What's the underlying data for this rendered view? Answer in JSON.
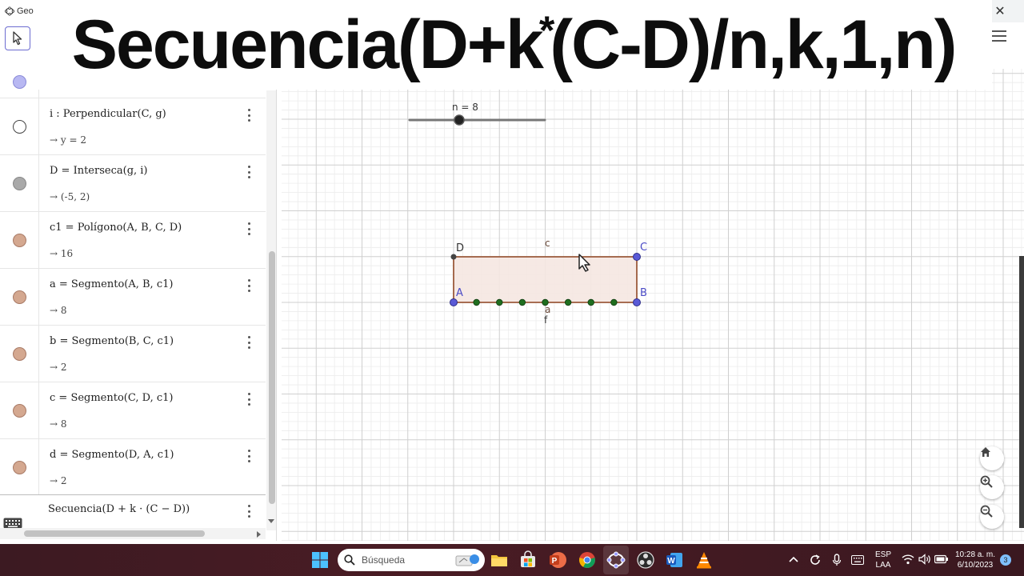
{
  "browser": {
    "tab_title": "Geo",
    "close_glyph": "✕"
  },
  "overlay": {
    "title_part1": "Secuencia(D+k",
    "title_sup": "*",
    "title_part2": "(C-D)/n,k,1,n)"
  },
  "algebra": {
    "rows": [
      {
        "definition": "i : Perpendicular(C, g)",
        "value": "→ y = 2",
        "marker": "hollow"
      },
      {
        "definition": "D = Interseca(g, i)",
        "value": "→ (-5, 2)",
        "marker": "#a9a9a9"
      },
      {
        "definition": "c1 = Polígono(A, B, C, D)",
        "value": "→ 16",
        "marker": "#d4a890"
      },
      {
        "definition": "a = Segmento(A, B, c1)",
        "value": "→ 8",
        "marker": "#d4a890"
      },
      {
        "definition": "b = Segmento(B, C, c1)",
        "value": "→ 2",
        "marker": "#d4a890"
      },
      {
        "definition": "c = Segmento(C, D, c1)",
        "value": "→ 8",
        "marker": "#d4a890"
      },
      {
        "definition": "d = Segmento(D, A, c1)",
        "value": "→ 2",
        "marker": "#d4a890"
      }
    ],
    "input_row": "Secuencia(D + k · (C − D))"
  },
  "graphics": {
    "slider_label": "n = 8",
    "slider_value": 8,
    "point_labels": {
      "D": "D",
      "C": "C",
      "A": "A",
      "B": "B"
    },
    "segment_labels": {
      "top": "c",
      "bottom_a": "a",
      "bottom_f": "f"
    },
    "colors": {
      "polygon_stroke": "#9c5b3c",
      "polygon_fill": "#f5e7e1",
      "free_point": "#5a5ad6",
      "dependent_point": "#444444",
      "sequence_point": "#1f6e1f",
      "grid_major": "#cfcfcf",
      "grid_minor": "#ececec"
    }
  },
  "taskbar": {
    "search_placeholder": "Búsqueda",
    "lang_top": "ESP",
    "lang_bottom": "LAA",
    "time": "10:28 a. m.",
    "date": "6/10/2023",
    "notification_count": "3"
  },
  "icons": [
    "geogebra-icon",
    "cursor-icon",
    "hamburger-icon",
    "home-icon",
    "zoom-in-icon",
    "zoom-out-icon",
    "keyboard-icon",
    "windows-icon",
    "search-icon",
    "file-explorer-icon",
    "store-icon",
    "powerpoint-icon",
    "chrome-icon",
    "geogebra-task-icon",
    "obs-icon",
    "word-icon",
    "vlc-icon",
    "chevron-up-icon",
    "refresh-icon",
    "mic-icon",
    "keyboard-tray-icon",
    "wifi-icon",
    "volume-icon",
    "battery-icon"
  ]
}
